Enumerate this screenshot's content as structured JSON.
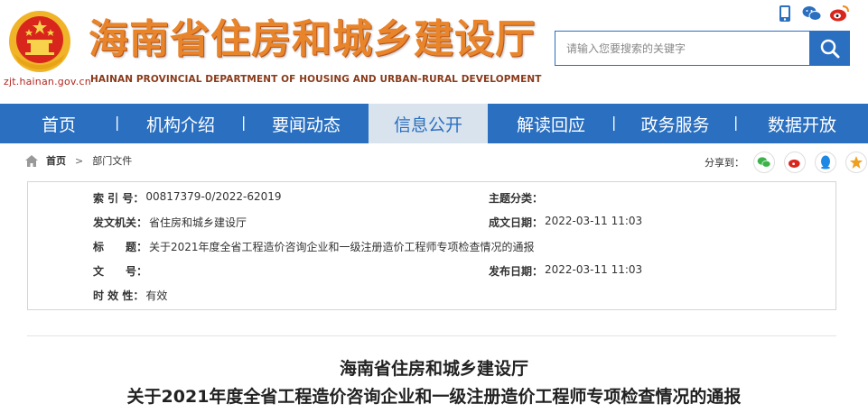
{
  "header": {
    "site_title": "海南省住房和城乡建设厅",
    "site_subtitle": "HAINAN PROVINCIAL DEPARTMENT OF HOUSING AND URBAN-RURAL DEVELOPMENT",
    "domain": "zjt.hainan.gov.cn",
    "top_icons": [
      "mobile-icon",
      "wechat-icon",
      "weibo-icon"
    ],
    "search": {
      "placeholder": "请输入您要搜索的关键字"
    },
    "colors": {
      "brand_blue": "#2a6fc0",
      "title_orange": "#e8842a",
      "emblem_red": "#d8261c"
    }
  },
  "nav": {
    "items": [
      {
        "label": "首页"
      },
      {
        "label": "机构介绍"
      },
      {
        "label": "要闻动态"
      },
      {
        "label": "信息公开",
        "active": true
      },
      {
        "label": "解读回应"
      },
      {
        "label": "政务服务"
      },
      {
        "label": "数据开放"
      }
    ],
    "separator": "|"
  },
  "breadcrumb": {
    "home": "首页",
    "sep": ">",
    "current": "部门文件"
  },
  "share": {
    "label": "分享到："
  },
  "meta": {
    "index_label": "索 引 号：",
    "index_value": "00817379-0/2022-62019",
    "topic_label": "主题分类：",
    "topic_value": "",
    "issuer_label": "发文机关：",
    "issuer_value": "省住房和城乡建设厅",
    "created_label": "成文日期：",
    "created_value": "2022-03-11 11:03",
    "title_label": "标　　题：",
    "title_value": "关于2021年度全省工程造价咨询企业和一级注册造价工程师专项检查情况的通报",
    "docno_label": "文　　号：",
    "docno_value": "",
    "published_label": "发布日期：",
    "published_value": "2022-03-11 11:03",
    "validity_label": "时 效 性：",
    "validity_value": "有效"
  },
  "document": {
    "title_line1": "海南省住房和城乡建设厅",
    "title_line2": "关于2021年度全省工程造价咨询企业和一级注册造价工程师专项检查情况的通报"
  }
}
